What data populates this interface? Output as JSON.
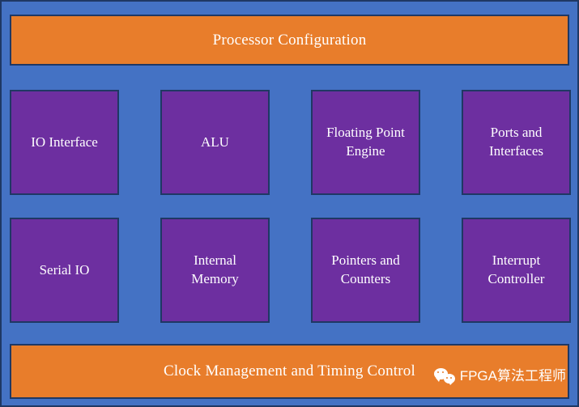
{
  "diagram": {
    "type": "block-diagram",
    "title_bar": {
      "label": "Processor Configuration"
    },
    "footer_bar": {
      "label": "Clock Management and Timing Control"
    },
    "blocks": [
      {
        "label": "IO Interface"
      },
      {
        "label": "ALU"
      },
      {
        "label": "Floating Point\nEngine"
      },
      {
        "label": "Ports and\nInterfaces"
      },
      {
        "label": "Serial IO"
      },
      {
        "label": "Internal\nMemory"
      },
      {
        "label": "Pointers and\nCounters"
      },
      {
        "label": "Interrupt\nController"
      }
    ],
    "watermark": {
      "icon": "wechat-icon",
      "label": "FPGA算法工程师"
    },
    "colors": {
      "background": "#4472C4",
      "bar_fill": "#E87D2B",
      "block_fill": "#6D2FA0",
      "border": "#1F3864",
      "text": "#FFFFFF"
    }
  }
}
